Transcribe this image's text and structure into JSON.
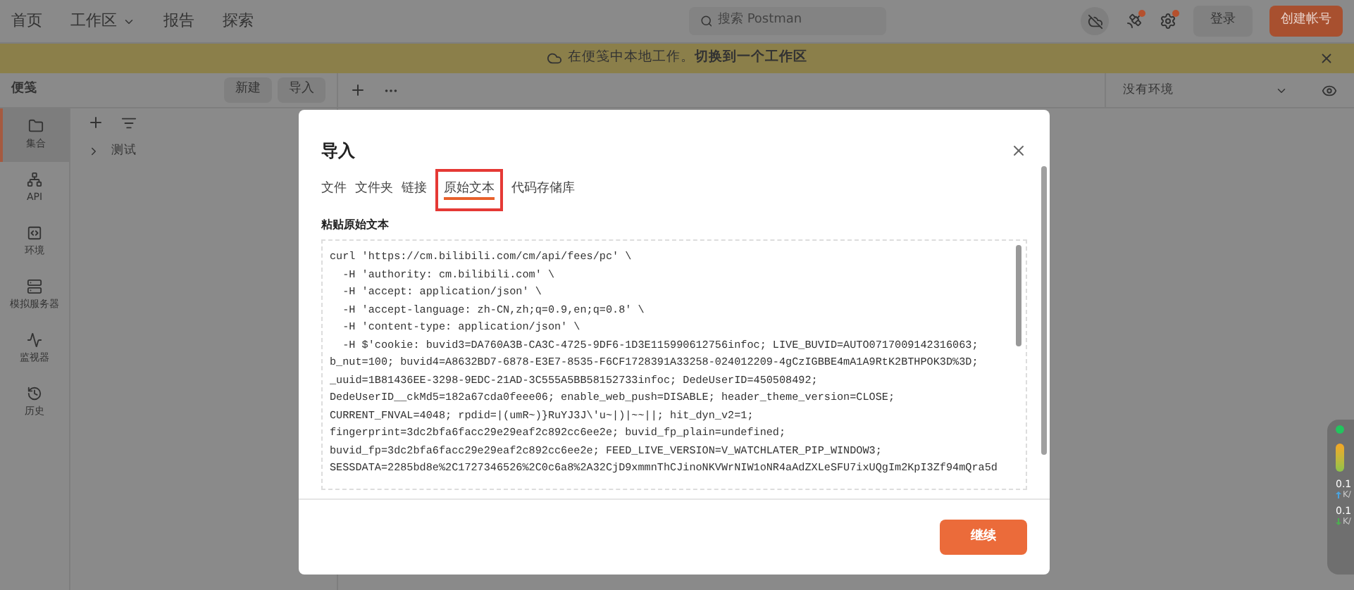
{
  "top_nav": {
    "items": [
      {
        "label": "首页",
        "has_menu": false
      },
      {
        "label": "工作区",
        "has_menu": true
      },
      {
        "label": "报告",
        "has_menu": false
      },
      {
        "label": "探索",
        "has_menu": false
      }
    ],
    "search": {
      "placeholder": "搜索 Postman"
    },
    "notifications": [
      {
        "kind": "satellite",
        "alert": true
      },
      {
        "kind": "settings",
        "alert": true
      }
    ],
    "sign_in": "登录",
    "create_account": "创建帐号"
  },
  "banner": {
    "text": "在便笺中本地工作。**切换到一个工作区**"
  },
  "subheader": {
    "title": "便笺",
    "buttons": [
      "新建",
      "导入"
    ],
    "environment": "没有环境"
  },
  "rail": [
    {
      "label": "集合",
      "selected": true
    },
    {
      "label": "API",
      "selected": false
    },
    {
      "label": "环境",
      "selected": false
    },
    {
      "label": "模拟服务器",
      "selected": false
    },
    {
      "label": "监视器",
      "selected": false
    },
    {
      "label": "历史",
      "selected": false
    }
  ],
  "tree": [
    {
      "label": "测试",
      "expanded": false
    }
  ],
  "dialog": {
    "title": "导入",
    "tabs": [
      {
        "label": "文件",
        "selected": false
      },
      {
        "label": "文件夹",
        "selected": false
      },
      {
        "label": "链接",
        "selected": false
      },
      {
        "label": "原始文本",
        "selected": true
      },
      {
        "label": "代码存储库",
        "selected": false
      }
    ],
    "field_label": "粘贴原始文本",
    "raw_text": [
      "curl 'https://cm.bilibili.com/cm/api/fees/pc' \\",
      "  -H 'authority: cm.bilibili.com' \\",
      "  -H 'accept: application/json' \\",
      "  -H 'accept-language: zh-CN,zh;q=0.9,en;q=0.8' \\",
      "  -H 'content-type: application/json' \\",
      "  -H $'cookie: buvid3=DA760A3B-CA3C-4725-9DF6-1D3E115990612756infoc; LIVE_BUVID=AUTO0717009142316063;",
      "b_nut=100; buvid4=A8632BD7-6878-E3E7-8535-F6CF1728391A33258-024012209-4gCzIGBBE4mA1A9RtK2BTHPOK3D%3D;",
      "_uuid=1B81436EE-3298-9EDC-21AD-3C555A5BB58152733infoc; DedeUserID=450508492;",
      "DedeUserID__ckMd5=182a67cda0feee06; enable_web_push=DISABLE; header_theme_version=CLOSE;",
      "CURRENT_FNVAL=4048; rpdid=|(umR~)}RuYJ3J\\'u~|)|~~||; hit_dyn_v2=1;",
      "fingerprint=3dc2bfa6facc29e29eaf2c892cc6ee2e; buvid_fp_plain=undefined;",
      "buvid_fp=3dc2bfa6facc29e29eaf2c892cc6ee2e; FEED_LIVE_VERSION=V_WATCHLATER_PIP_WINDOW3;",
      "SESSDATA=2285bd8e%2C1727346526%2C0c6a8%2A32CjD9xmmnThCJinoNKVWrNIW1oNR4aAdZXLeSFU7ixUQgIm2KpI3Zf94mQra5d"
    ],
    "continue": "继续"
  },
  "speed_widget": {
    "upload": "0.1",
    "upload_unit": "K/",
    "download": "0.1",
    "download_unit": "K/"
  }
}
